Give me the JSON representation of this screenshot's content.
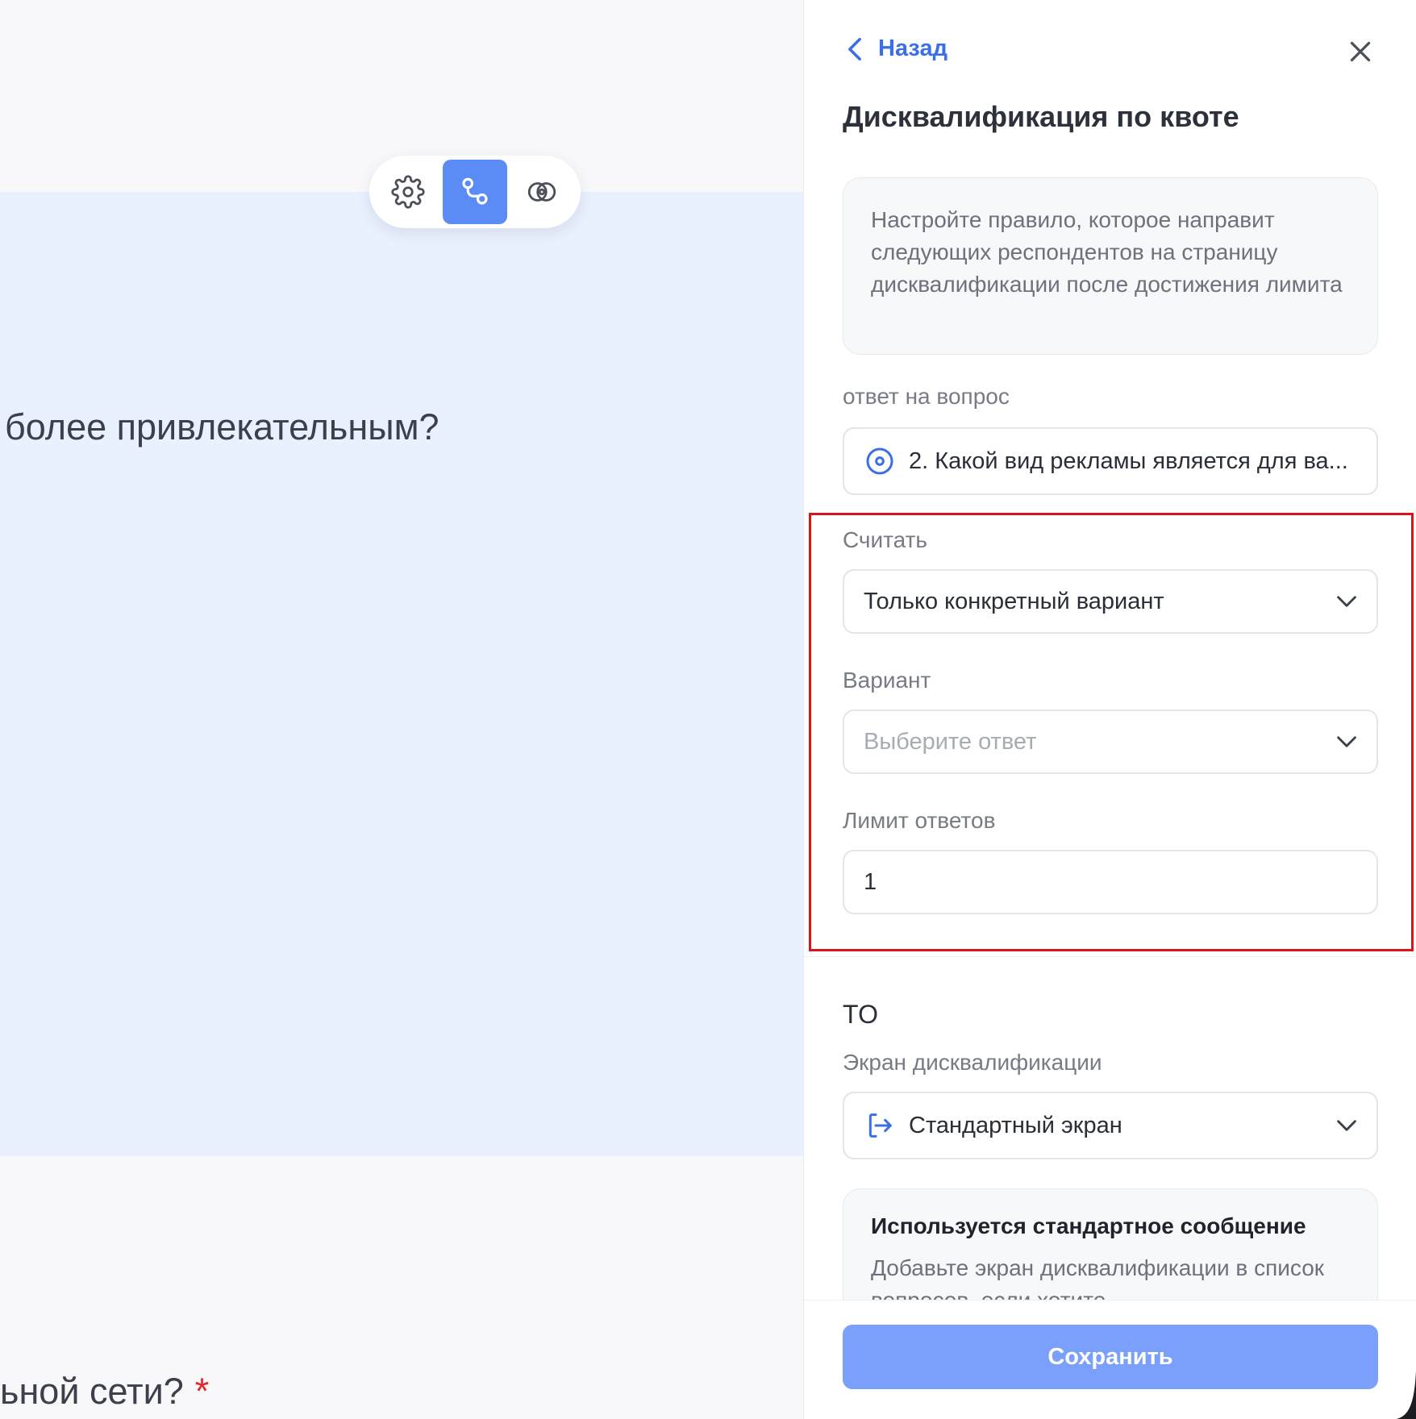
{
  "editor": {
    "question_fragment": "более привлекательным?",
    "question_fragment_2": "ьной сети?",
    "required_mark": "*",
    "toolbar": [
      {
        "name": "settings",
        "icon": "gear-icon",
        "active": false
      },
      {
        "name": "logic",
        "icon": "branch-logic-icon",
        "active": true
      },
      {
        "name": "visibility",
        "icon": "eye-icon",
        "active": false
      }
    ]
  },
  "panel": {
    "back_label": "Назад",
    "title": "Дисквалификация по квоте",
    "info": "Настройте правило, которое направит следующих респондентов на страницу дисквалификации после достижения лимита",
    "question_label": "ответ на вопрос",
    "question_value": "2. Какой вид рекламы является для ва...",
    "count_label": "Считать",
    "count_value": "Только конкретный вариант",
    "variant_label": "Вариант",
    "variant_placeholder": "Выберите ответ",
    "limit_label": "Лимит ответов",
    "limit_value": "1",
    "then_label": "ТО",
    "screen_label": "Экран дисквалификации",
    "screen_value": "Стандартный экран",
    "std_title": "Используется стандартное сообщение",
    "std_text": "Добавьте экран дисквалификации в список вопросов, если хотите",
    "save_label": "Сохранить"
  },
  "colors": {
    "accent": "#3b6fe6",
    "toolbar_active": "#5b8cf5",
    "save_button": "#7aa0fb",
    "highlight": "#d9151c",
    "question_bg": "#e9f0fe"
  }
}
